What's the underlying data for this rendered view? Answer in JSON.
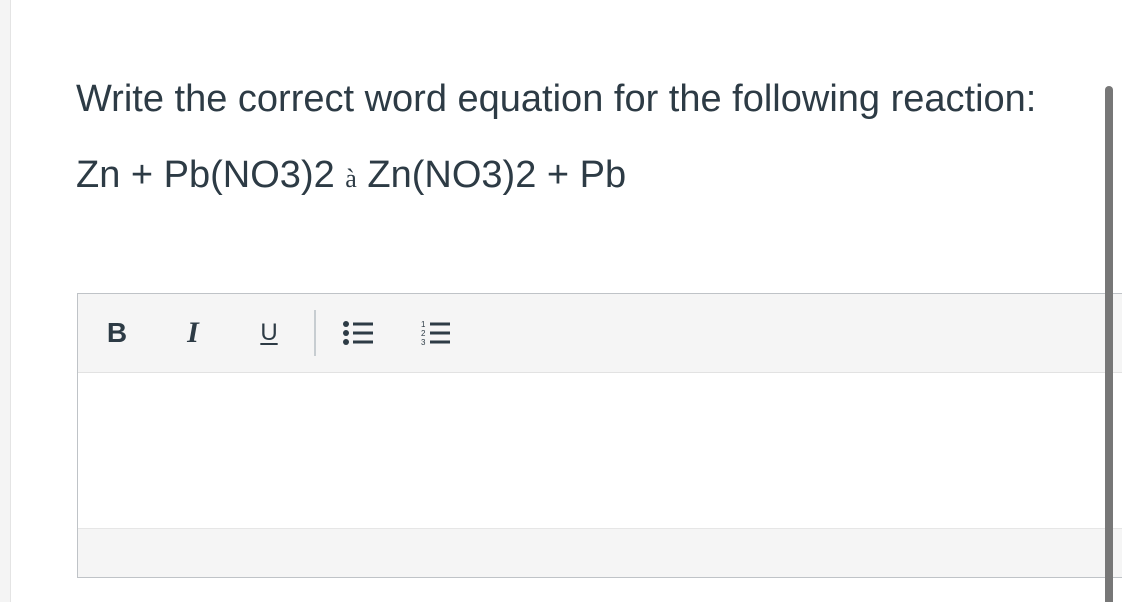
{
  "question": {
    "prompt": "Write the correct word equation for the following reaction:",
    "equation": {
      "lhs_1": "Zn + Pb(NO",
      "lhs_sub_1": "3",
      "lhs_2": ")",
      "lhs_sub_2": "2",
      "arrow": "à",
      "rhs_1": "Zn(NO",
      "rhs_sub_1": "3",
      "rhs_2": ")",
      "rhs_sub_2": "2",
      "rhs_3": " + Pb"
    }
  },
  "editor": {
    "toolbar": {
      "bold_label": "B",
      "italic_label": "I",
      "underline_label": "U",
      "bullet_list_icon": "bullet-list-icon",
      "numbered_list_icon": "numbered-list-icon"
    },
    "content": ""
  },
  "colors": {
    "text": "#2d3b45",
    "toolbar_bg": "#f5f5f5",
    "border": "#bfc3c7",
    "scrollbar": "#777777"
  }
}
